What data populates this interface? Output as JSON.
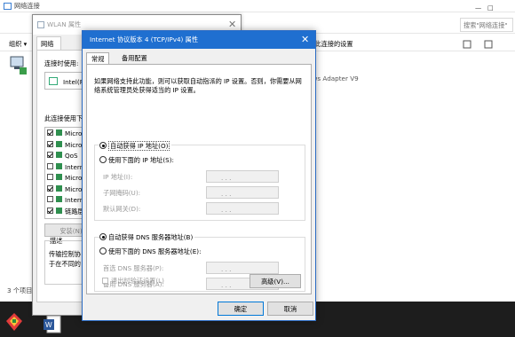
{
  "explorer": {
    "title": "网络连接",
    "search_placeholder": "搜索\"网络连接\"",
    "cmd_organize": "组织 ▾",
    "cmd_change_settings": "更改此连接的设置",
    "adapter_text": "ndows Adapter V9",
    "status_count": "3 个项目"
  },
  "wlan": {
    "title": "WLAN 属性",
    "tab_network": "网络",
    "connect_using_label": "连接时使用:",
    "adapter_name": "Intel(R)",
    "items_label": "此连接使用下列",
    "items": [
      {
        "label": "Micro",
        "checked": true
      },
      {
        "label": "Micro",
        "checked": true
      },
      {
        "label": "QoS",
        "checked": true
      },
      {
        "label": "Intern",
        "checked": false
      },
      {
        "label": "Micro",
        "checked": false
      },
      {
        "label": "Micro",
        "checked": true
      },
      {
        "label": "Intern",
        "checked": false
      },
      {
        "label": "链路层",
        "checked": true
      }
    ],
    "install_button": "安装(N)",
    "description_label": "描述",
    "description_text_1": "传输控制协",
    "description_text_2": "于在不同的"
  },
  "dialog": {
    "title": "Internet 协议版本 4 (TCP/IPv4) 属性",
    "tab_general": "常规",
    "tab_alternate": "备用配置",
    "description": "如果网络支持此功能，则可以获取自动指派的 IP 设置。否则，你需要从网络系统管理员处获得适当的 IP 设置。",
    "auto_ip": "自动获得 IP 地址(O)",
    "manual_ip": "使用下面的 IP 地址(S):",
    "ip_label": "IP 地址(I):",
    "subnet_label": "子网掩码(U):",
    "gateway_label": "默认网关(D):",
    "auto_dns": "自动获得 DNS 服务器地址(B)",
    "manual_dns": "使用下面的 DNS 服务器地址(E):",
    "pref_dns_label": "首选 DNS 服务器(P):",
    "alt_dns_label": "备用 DNS 服务器(A):",
    "ip_dots": ".       .       .",
    "validate_label": "退出时验证设置(L)",
    "advanced_button": "高级(V)...",
    "ok_button": "确定",
    "cancel_button": "取消",
    "auto_ip_selected": true,
    "auto_dns_selected": true
  },
  "colors": {
    "title_accent": "#1f6fd0",
    "taskbar": "#1d1d1d"
  }
}
